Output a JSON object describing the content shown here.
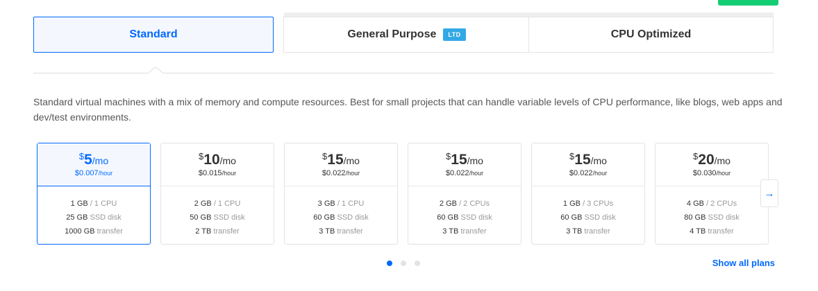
{
  "tabs": [
    {
      "label": "Standard",
      "active": true
    },
    {
      "label": "General Purpose",
      "badge": "LTD",
      "active": false
    },
    {
      "label": "CPU Optimized",
      "active": false
    }
  ],
  "description": "Standard virtual machines with a mix of memory and compute resources. Best for small projects that can handle variable levels of CPU performance, like blogs, web apps and dev/test environments.",
  "plans": [
    {
      "currency": "$",
      "amount": "5",
      "per": "/mo",
      "hourly": "$0.007",
      "hourly_unit": "/hour",
      "memory": "1 GB",
      "cpu": "/ 1 CPU",
      "disk": "25 GB",
      "disk_label": "SSD disk",
      "transfer": "1000 GB",
      "transfer_label": "transfer",
      "selected": true
    },
    {
      "currency": "$",
      "amount": "10",
      "per": "/mo",
      "hourly": "$0.015",
      "hourly_unit": "/hour",
      "memory": "2 GB",
      "cpu": "/ 1 CPU",
      "disk": "50 GB",
      "disk_label": "SSD disk",
      "transfer": "2 TB",
      "transfer_label": "transfer",
      "selected": false
    },
    {
      "currency": "$",
      "amount": "15",
      "per": "/mo",
      "hourly": "$0.022",
      "hourly_unit": "/hour",
      "memory": "3 GB",
      "cpu": "/ 1 CPU",
      "disk": "60 GB",
      "disk_label": "SSD disk",
      "transfer": "3 TB",
      "transfer_label": "transfer",
      "selected": false
    },
    {
      "currency": "$",
      "amount": "15",
      "per": "/mo",
      "hourly": "$0.022",
      "hourly_unit": "/hour",
      "memory": "2 GB",
      "cpu": "/ 2 CPUs",
      "disk": "60 GB",
      "disk_label": "SSD disk",
      "transfer": "3 TB",
      "transfer_label": "transfer",
      "selected": false
    },
    {
      "currency": "$",
      "amount": "15",
      "per": "/mo",
      "hourly": "$0.022",
      "hourly_unit": "/hour",
      "memory": "1 GB",
      "cpu": "/ 3 CPUs",
      "disk": "60 GB",
      "disk_label": "SSD disk",
      "transfer": "3 TB",
      "transfer_label": "transfer",
      "selected": false
    },
    {
      "currency": "$",
      "amount": "20",
      "per": "/mo",
      "hourly": "$0.030",
      "hourly_unit": "/hour",
      "memory": "4 GB",
      "cpu": "/ 2 CPUs",
      "disk": "80 GB",
      "disk_label": "SSD disk",
      "transfer": "4 TB",
      "transfer_label": "transfer",
      "selected": false
    }
  ],
  "next_arrow": "→",
  "next_icon": "arrow-right-icon",
  "pagination": {
    "pages": 3,
    "current": 1
  },
  "show_all_label": "Show all plans",
  "colors": {
    "accent": "#0069ff",
    "badge": "#33a8e6",
    "green": "#15cd72"
  }
}
